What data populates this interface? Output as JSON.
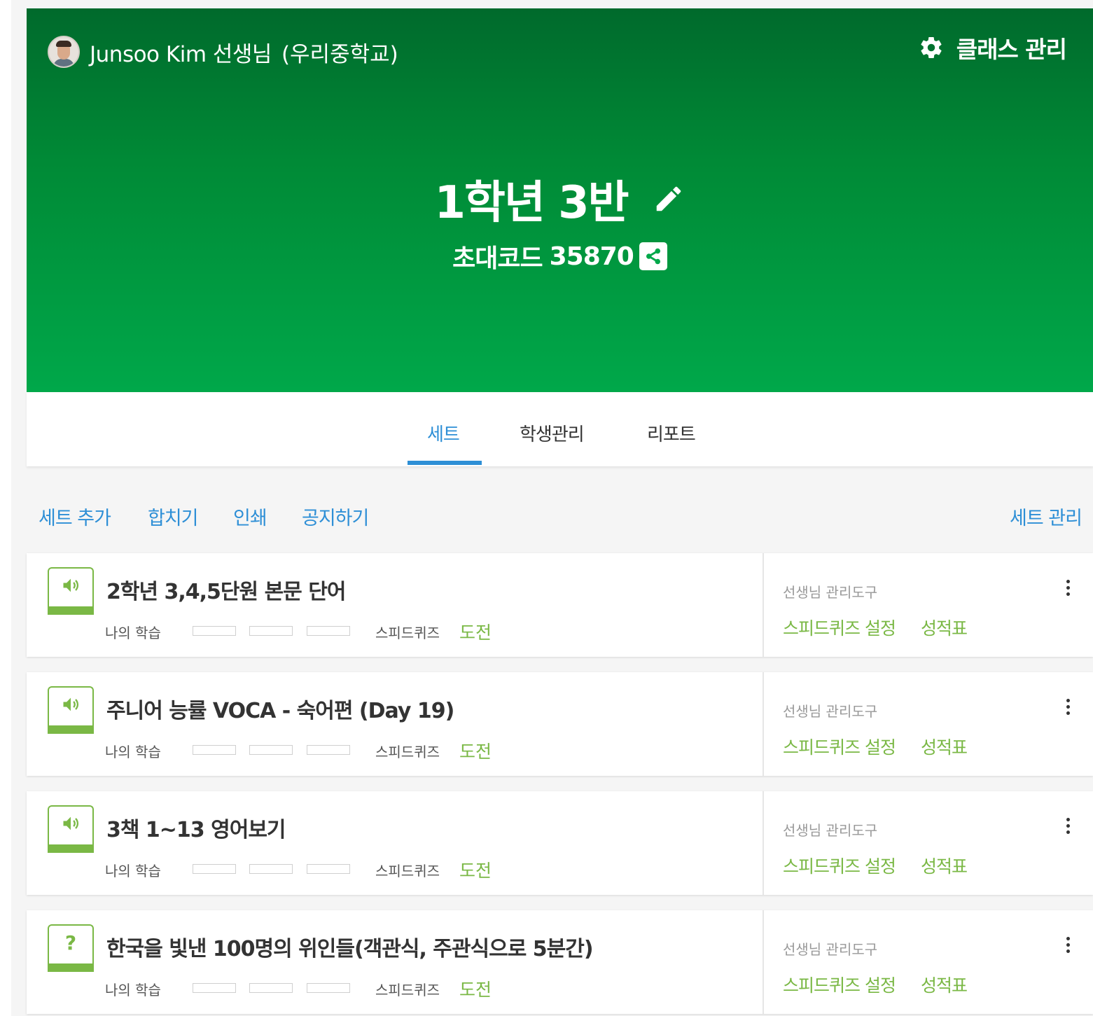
{
  "header": {
    "teacher_name": "Junsoo Kim 선생님",
    "school": "(우리중학교)",
    "class_manage_label": "클래스 관리",
    "class_title": "1학년 3반",
    "invite_label": "초대코드",
    "invite_code": "35870"
  },
  "tabs": [
    {
      "label": "세트",
      "active": true
    },
    {
      "label": "학생관리",
      "active": false
    },
    {
      "label": "리포트",
      "active": false
    }
  ],
  "actions": {
    "add_set": "세트 추가",
    "merge": "합치기",
    "print": "인쇄",
    "announce": "공지하기",
    "set_manage": "세트 관리"
  },
  "card_labels": {
    "my_learning": "나의 학습",
    "speed_quiz": "스피드퀴즈",
    "challenge": "도전",
    "teacher_tools": "선생님 관리도구",
    "speed_quiz_settings": "스피드퀴즈 설정",
    "gradebook": "성적표"
  },
  "sets": [
    {
      "title": "2학년 3,4,5단원 본문 단어",
      "icon": "speaker-icon"
    },
    {
      "title": "주니어 능률 VOCA - 숙어편 (Day 19)",
      "icon": "speaker-icon"
    },
    {
      "title": "3책 1~13 영어보기",
      "icon": "speaker-icon"
    },
    {
      "title": "한국을 빛낸 100명의 위인들(객관식, 주관식으로 5분간)",
      "icon": "question-icon",
      "icon_text": "?"
    }
  ],
  "colors": {
    "header_green_top": "#006a2c",
    "header_green_bottom": "#00a84a",
    "accent_blue": "#2e8fd6",
    "accent_green": "#7ab845"
  }
}
